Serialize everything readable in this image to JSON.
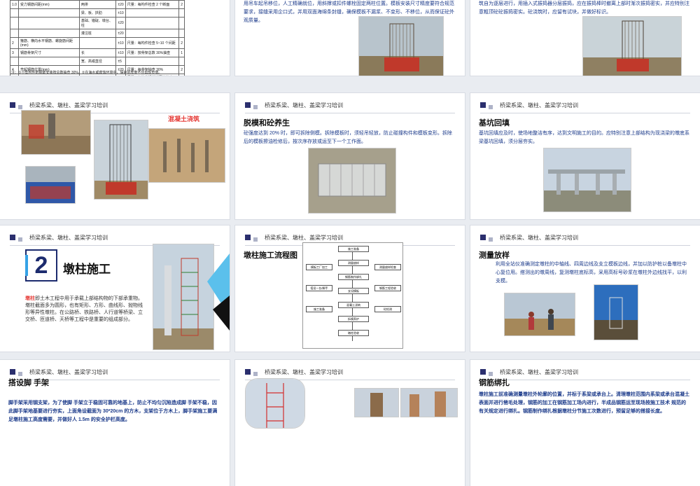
{
  "header_text": "桥梁系梁、墩柱、盖梁学习培训",
  "slide_r0c0": {
    "table_rows": [
      [
        "1.0",
        "受力钢筋间距(mm)",
        "两排",
        "±20",
        "尺量：每构件检查 2 个断面",
        "2"
      ],
      [
        "",
        "",
        "梁、板、拱肋",
        "±10",
        "",
        ""
      ],
      [
        "",
        "",
        "基础、锚碇、墩台、柱",
        "±20",
        "",
        ""
      ],
      [
        "",
        "",
        "灌注桩",
        "±20",
        "",
        ""
      ],
      [
        "2",
        "箍筋、横向水平钢筋、螺旋筋间距(mm)",
        "",
        "±10",
        "尺量：每构件检查 5~10 个间距",
        "2"
      ],
      [
        "3",
        "钢筋骨架尺寸",
        "长",
        "±10",
        "尺量：按骨架总数 30%抽查",
        "1"
      ],
      [
        "",
        "",
        "宽、高或直径",
        "±5",
        "",
        ""
      ],
      [
        "4",
        "弯起钢筋位置(mm)",
        "",
        "±20",
        "尺量：每骨架抽查 30%",
        "2"
      ],
      [
        "5",
        "保护层厚度(mm)",
        "柱、梁、拱肋",
        "±5",
        "尺量：每构件沿模板周边检查 8 处",
        "3"
      ],
      [
        "",
        "",
        "基础、锚碇、墩台",
        "±10",
        "",
        ""
      ],
      [
        "",
        "",
        "板",
        "±3",
        "",
        ""
      ]
    ],
    "note": "注：①小型构件的钢筋安装按总数抽查 30%。②在海水或腐蚀环境中，保护层厚度不应出现负值。"
  },
  "slide_r0c1": {
    "body": "用吊车起吊移位，人工精确就位，用斜撑或扣件螺栓固定两柱位置。模板安装尺寸精度要符合规范要求，接缝采用企口式，并用双面海绵条封缝，确保模板不漏浆、不变形、不移位，从而保证砼外观质量。"
  },
  "slide_r0c2": {
    "body": "筑自为逐层进行，用插入式振捣器分层振捣，应在振捣棒时撤离上部时渐次振捣密实，并应特别注意粗顶砼砼振捣密实。砼浇筑时，应留有试块，并做好标识。"
  },
  "slide_r1c0": {
    "label": "混凝土浇筑"
  },
  "slide_r1c1": {
    "title": "脱模和砼养生",
    "body": "砼强度达到 20% 时，即可拆除侧模。拆除模板时，须轻吊轻放，防止碰撞构件和模板变形。拆除后的模板擦油检修后，按次序存放或运至下一个工作面。"
  },
  "slide_r1c2": {
    "title": "基坑回填",
    "body": "基坑回填应及时，使场地整洁有序，达到文明施工的目的。应特别注意上部结构为现浇梁的墩底系梁基坑回填，须分层夯实。"
  },
  "slide_r2c0": {
    "number": "2",
    "title": "墩柱施工",
    "body_lead": "墩柱",
    "body": "即土木工程中用于承载上部结构物的下部承重物。墩柱截面多为圆形，也有矩形、方形、曲线形、抛物线形等异性墩柱。在公路桥、铁路桥、人行道等桥梁、立交桥、匝道桥、天桥等工程中是重要的组成部分。"
  },
  "slide_r2c1": {
    "title": "墩柱施工流程图",
    "flow_main": [
      "施工准备",
      "测量放样",
      "钢筋制作绑扎",
      "支设模板",
      "混凝土浇筑",
      "拆模养护",
      "墩柱验收"
    ],
    "flow_left": [
      "模板工厂加工",
      "搭设一台/脚手",
      "施工准备"
    ],
    "flow_right": [
      "测量放样检查",
      "钢筋工程验收",
      "砼检测"
    ]
  },
  "slide_r2c2": {
    "title": "测量放样",
    "body": "利用全站仪准确测定墩柱的中轴线、四周边线及支立模板边线，并加以防护桩以备墩柱中心复位用。搭测出的墩周线，复测墩柱底标高，采用高标号砂浆在墩柱外边线找平，以利支模。"
  },
  "slide_r3c0": {
    "title": "搭设脚 手架",
    "body": "脚手架采用钢支架，为了使脚 手架立于稳固可靠的地基上，防止不均匀沉陷造成脚 手架不稳，因此脚手架地基要进行夯实，上面角设截面为 30*20cm 的方木，支架位于方木上，脚手架施工要满足墩柱施工高度需要，并做好人 1.5m 的安全护栏高度。"
  },
  "slide_r3c2": {
    "title": "钢筋绑扎",
    "body": "墩柱施工前准确测量墩柱外轮廓的位置，并标于系梁或承台上。清理墩柱范围内系梁或承台混凝土表面并进行凿毛处理，钢筋的加工在钢筋加工场内进行，半成品钢筋运至现场按施工技术 规范的有关规定进行绑扎。钢筋制作绑扎根据墩柱分节施工次数进行，预留足够的搭接长度。"
  }
}
